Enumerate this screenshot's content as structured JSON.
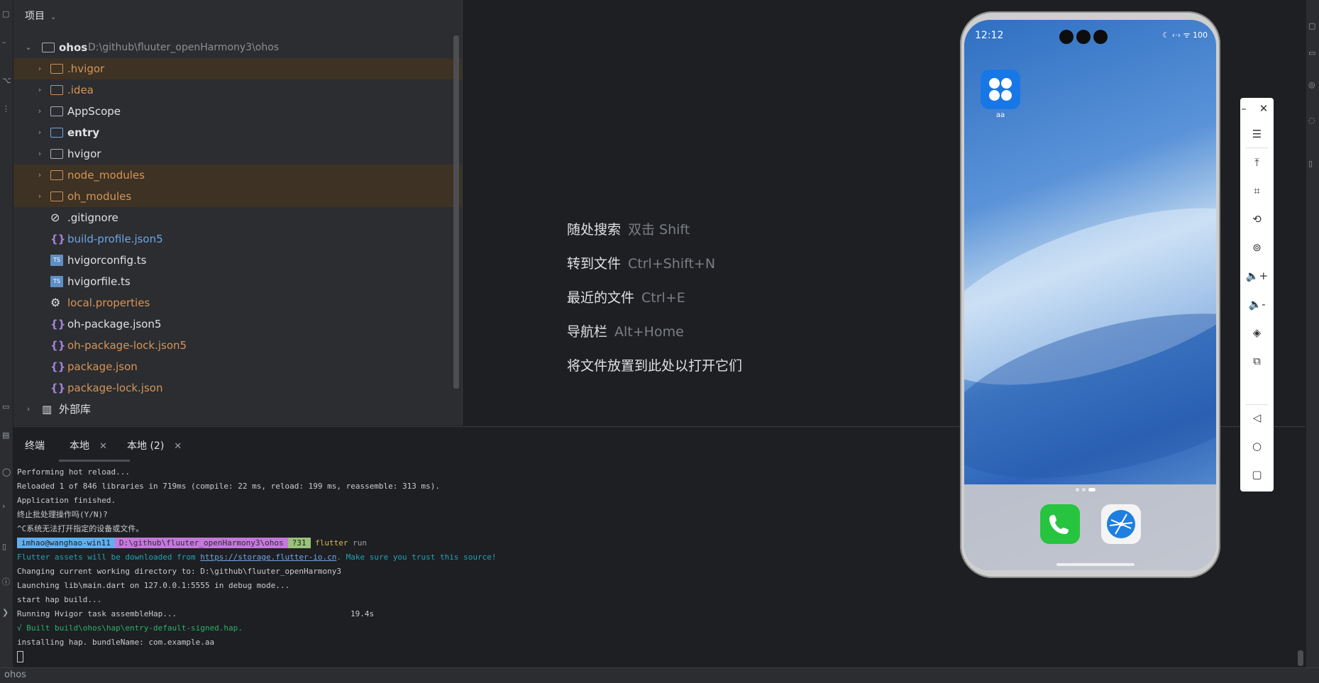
{
  "project": {
    "header": "项目",
    "root": {
      "name": "ohos",
      "path": "D:\\github\\fluuter_openHarmony3\\ohos"
    },
    "items": [
      {
        "label": ".hvigor",
        "type": "folder"
      },
      {
        "label": ".idea",
        "type": "folder"
      },
      {
        "label": "AppScope",
        "type": "folder"
      },
      {
        "label": "entry",
        "type": "folder"
      },
      {
        "label": "hvigor",
        "type": "folder"
      },
      {
        "label": "node_modules",
        "type": "folder"
      },
      {
        "label": "oh_modules",
        "type": "folder"
      },
      {
        "label": ".gitignore",
        "type": "file"
      },
      {
        "label": "build-profile.json5",
        "type": "json"
      },
      {
        "label": "hvigorconfig.ts",
        "type": "ts"
      },
      {
        "label": "hvigorfile.ts",
        "type": "ts"
      },
      {
        "label": "local.properties",
        "type": "props"
      },
      {
        "label": "oh-package.json5",
        "type": "json"
      },
      {
        "label": "oh-package-lock.json5",
        "type": "json"
      },
      {
        "label": "package.json",
        "type": "json"
      },
      {
        "label": "package-lock.json",
        "type": "json"
      }
    ],
    "external": "外部库"
  },
  "editor_hints": [
    {
      "label": "随处搜索",
      "shortcut": "双击 Shift"
    },
    {
      "label": "转到文件",
      "shortcut": "Ctrl+Shift+N"
    },
    {
      "label": "最近的文件",
      "shortcut": "Ctrl+E"
    },
    {
      "label": "导航栏",
      "shortcut": "Alt+Home"
    },
    {
      "label": "将文件放置到此处以打开它们",
      "shortcut": ""
    }
  ],
  "terminal": {
    "title": "终端",
    "tabs": [
      "本地",
      "本地 (2)"
    ],
    "lines": [
      "Performing hot reload...",
      "Reloaded 1 of 846 libraries in 719ms (compile: 22 ms, reload: 199 ms, reassemble: 313 ms).",
      "Application finished.",
      "终止批处理操作吗(Y/N)?",
      "^C系统无法打开指定的设备或文件。"
    ],
    "prompt": {
      "user": "imhao@wanghao-win11",
      "path": "D:\\github\\fluuter_openHarmony3\\ohos",
      "branch": "?31",
      "cmd": "flutter",
      "arg": "run"
    },
    "warn_pre": "Flutter assets will be downloaded from ",
    "warn_link": "https://storage.flutter-io.cn",
    "warn_post": ". Make sure you trust this source!",
    "lines2": [
      "Changing current working directory to: D:\\github\\fluuter_openHarmony3",
      "Launching lib\\main.dart on 127.0.0.1:5555 in debug mode...",
      "start hap build..."
    ],
    "task": "Running Hvigor task assembleHap...",
    "task_time": "19.4s",
    "built": "√ Built build\\ohos\\hap\\entry-default-signed.hap.",
    "installing": "installing hap. bundleName: com.example.aa"
  },
  "status": {
    "project": "ohos"
  },
  "phone": {
    "time": "12:12",
    "status_icons": "☾ ‹·› ᯤ 100",
    "app_label": "aa",
    "colors": {
      "app_blue": "#1877e6",
      "phone_green": "#27c43f"
    }
  },
  "icons": [
    "folder-icon",
    "json-icon",
    "ts-icon",
    "gear-icon",
    "ignore-icon",
    "chevron-right-icon",
    "close-icon",
    "minimize-icon",
    "menu-icon",
    "back-icon",
    "home-icon",
    "recents-icon"
  ]
}
